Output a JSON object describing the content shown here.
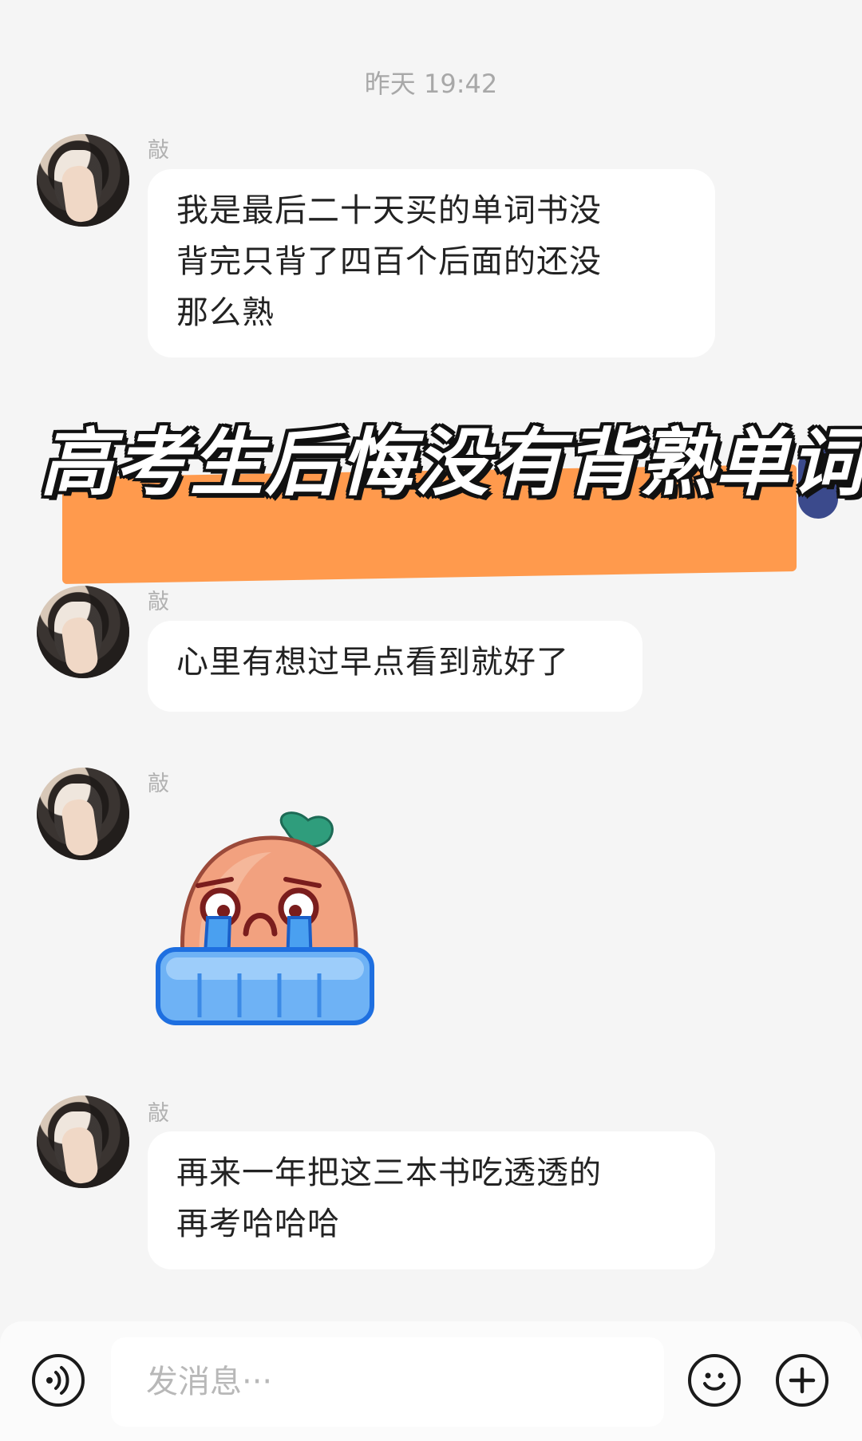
{
  "chat": {
    "timestamp": "昨天 19:42",
    "messages": [
      {
        "sender": "敲",
        "lines": [
          "我是最后二十天买的单词书没",
          "背完只背了四百个后面的还没",
          "那么熟"
        ]
      },
      {
        "sender": "敲",
        "lines": [
          "心里有想过早点看到就好了"
        ]
      },
      {
        "sender": "敲",
        "sticker": "crying-peach-sticker"
      },
      {
        "sender": "敲",
        "lines": [
          "再来一年把这三本书吃透透的",
          "再考哈哈哈"
        ]
      }
    ]
  },
  "overlay": {
    "title": "高考生后悔没有背熟单词书",
    "highlight_color": "#ff9a4d"
  },
  "input_bar": {
    "placeholder": "发消息···",
    "icons": [
      "voice-icon",
      "emoji-icon",
      "plus-icon"
    ]
  }
}
